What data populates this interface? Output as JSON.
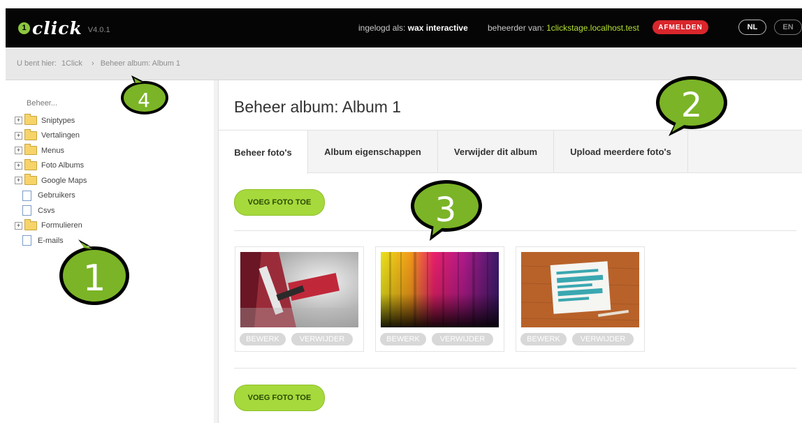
{
  "app": {
    "logo_badge": "1",
    "logo_text": "click",
    "version": "V4.0.1"
  },
  "header": {
    "logged_in_label": "ingelogd als:",
    "logged_in_user": "wax interactive",
    "admin_label": "beheerder van:",
    "admin_site": "1clickstage.localhost.test",
    "logout_label": "AFMELDEN",
    "lang_nl": "NL",
    "lang_en": "EN"
  },
  "breadcrumb": {
    "prefix": "U bent hier:",
    "home": "1Click",
    "separator": "›",
    "current": "Beheer album: Album 1"
  },
  "sidebar": {
    "root": "Beheer...",
    "items": [
      {
        "label": "Sniptypes",
        "type": "folder",
        "expandable": true
      },
      {
        "label": "Vertalingen",
        "type": "folder",
        "expandable": true
      },
      {
        "label": "Menus",
        "type": "folder",
        "expandable": true
      },
      {
        "label": "Foto Albums",
        "type": "folder",
        "expandable": true
      },
      {
        "label": "Google Maps",
        "type": "folder",
        "expandable": true
      },
      {
        "label": "Gebruikers",
        "type": "page",
        "expandable": false
      },
      {
        "label": "Csvs",
        "type": "page",
        "expandable": false
      },
      {
        "label": "Formulieren",
        "type": "folder",
        "expandable": true
      },
      {
        "label": "E-mails",
        "type": "page",
        "expandable": false
      }
    ]
  },
  "main": {
    "title": "Beheer album: Album 1",
    "tabs": [
      {
        "label": "Beheer foto's",
        "active": true
      },
      {
        "label": "Album eigenschappen",
        "active": false
      },
      {
        "label": "Verwijder dit album",
        "active": false
      },
      {
        "label": "Upload meerdere foto's",
        "active": false
      }
    ],
    "add_photo_label": "VOEG FOTO TOE",
    "photos": [
      {
        "edit_label": "BEWERK",
        "delete_label": "VERWIJDER"
      },
      {
        "edit_label": "BEWERK",
        "delete_label": "VERWIJDER"
      },
      {
        "edit_label": "BEWERK",
        "delete_label": "VERWIJDER"
      }
    ]
  },
  "callouts": [
    "1",
    "2",
    "3",
    "4"
  ],
  "colors": {
    "accent_green": "#a6d93c",
    "logout_red": "#d9262c",
    "callout_green": "#7bb427"
  }
}
